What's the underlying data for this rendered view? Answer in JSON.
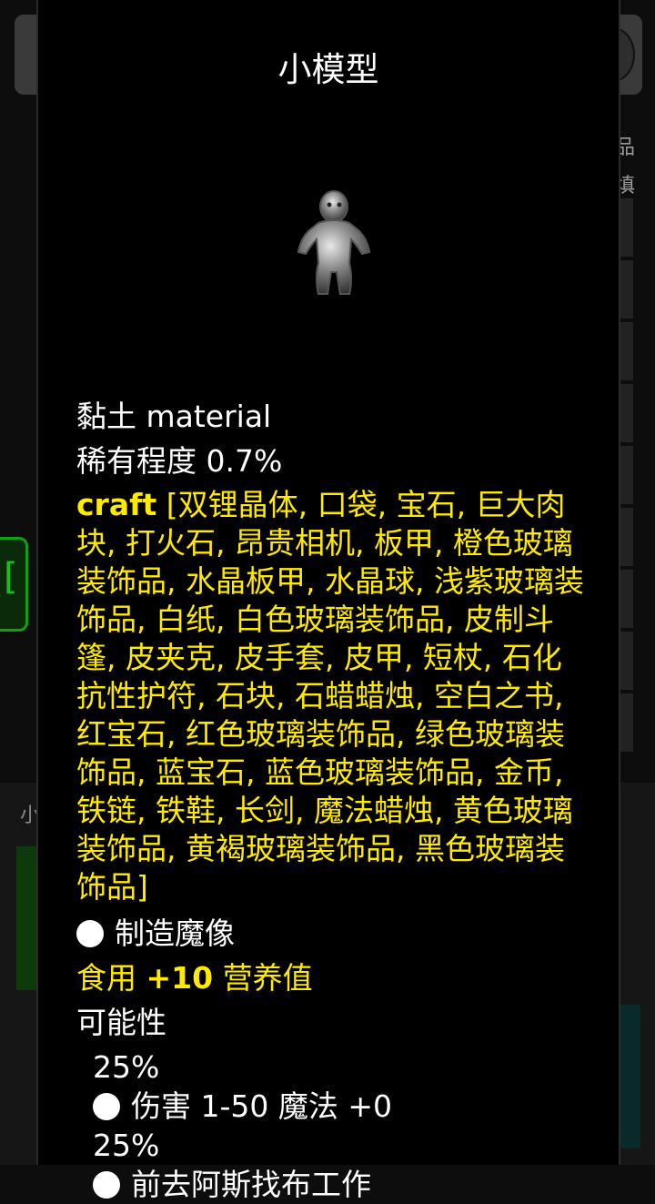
{
  "background": {
    "side_labels": [
      "品",
      "填"
    ],
    "lower_label": "小"
  },
  "dialog": {
    "title": "小模型",
    "image_icon": "figurine-icon",
    "material_line": "黏土 material",
    "rarity_line": "稀有程度 0.7%",
    "craft_label": "craft",
    "craft_list": " [双锂晶体, 口袋, 宝石, 巨大肉块, 打火石, 昂贵相机, 板甲, 橙色玻璃装饰品, 水晶板甲, 水晶球, 浅紫玻璃装饰品, 白纸, 白色玻璃装饰品, 皮制斗篷, 皮夹克, 皮手套, 皮甲, 短杖, 石化抗性护符, 石块, 石蜡蜡烛, 空白之书, 红宝石, 红色玻璃装饰品, 绿色玻璃装饰品, 蓝宝石, 蓝色玻璃装饰品, 金币, 铁链, 铁鞋, 长剑, 魔法蜡烛, 黄色玻璃装饰品, 黄褐玻璃装饰品, 黑色玻璃装饰品]",
    "effect": "制造魔像",
    "food_prefix": "食用 ",
    "food_value": "+10",
    "food_suffix": " 营养值",
    "possibility_label": "可能性",
    "outcomes": [
      {
        "chance": "25%",
        "text": "伤害 1-50 魔法 +0"
      },
      {
        "chance": "25%",
        "text": "前去阿斯找布工作"
      }
    ]
  },
  "colors": {
    "accent_yellow": "#ffea00",
    "background": "#000000"
  }
}
